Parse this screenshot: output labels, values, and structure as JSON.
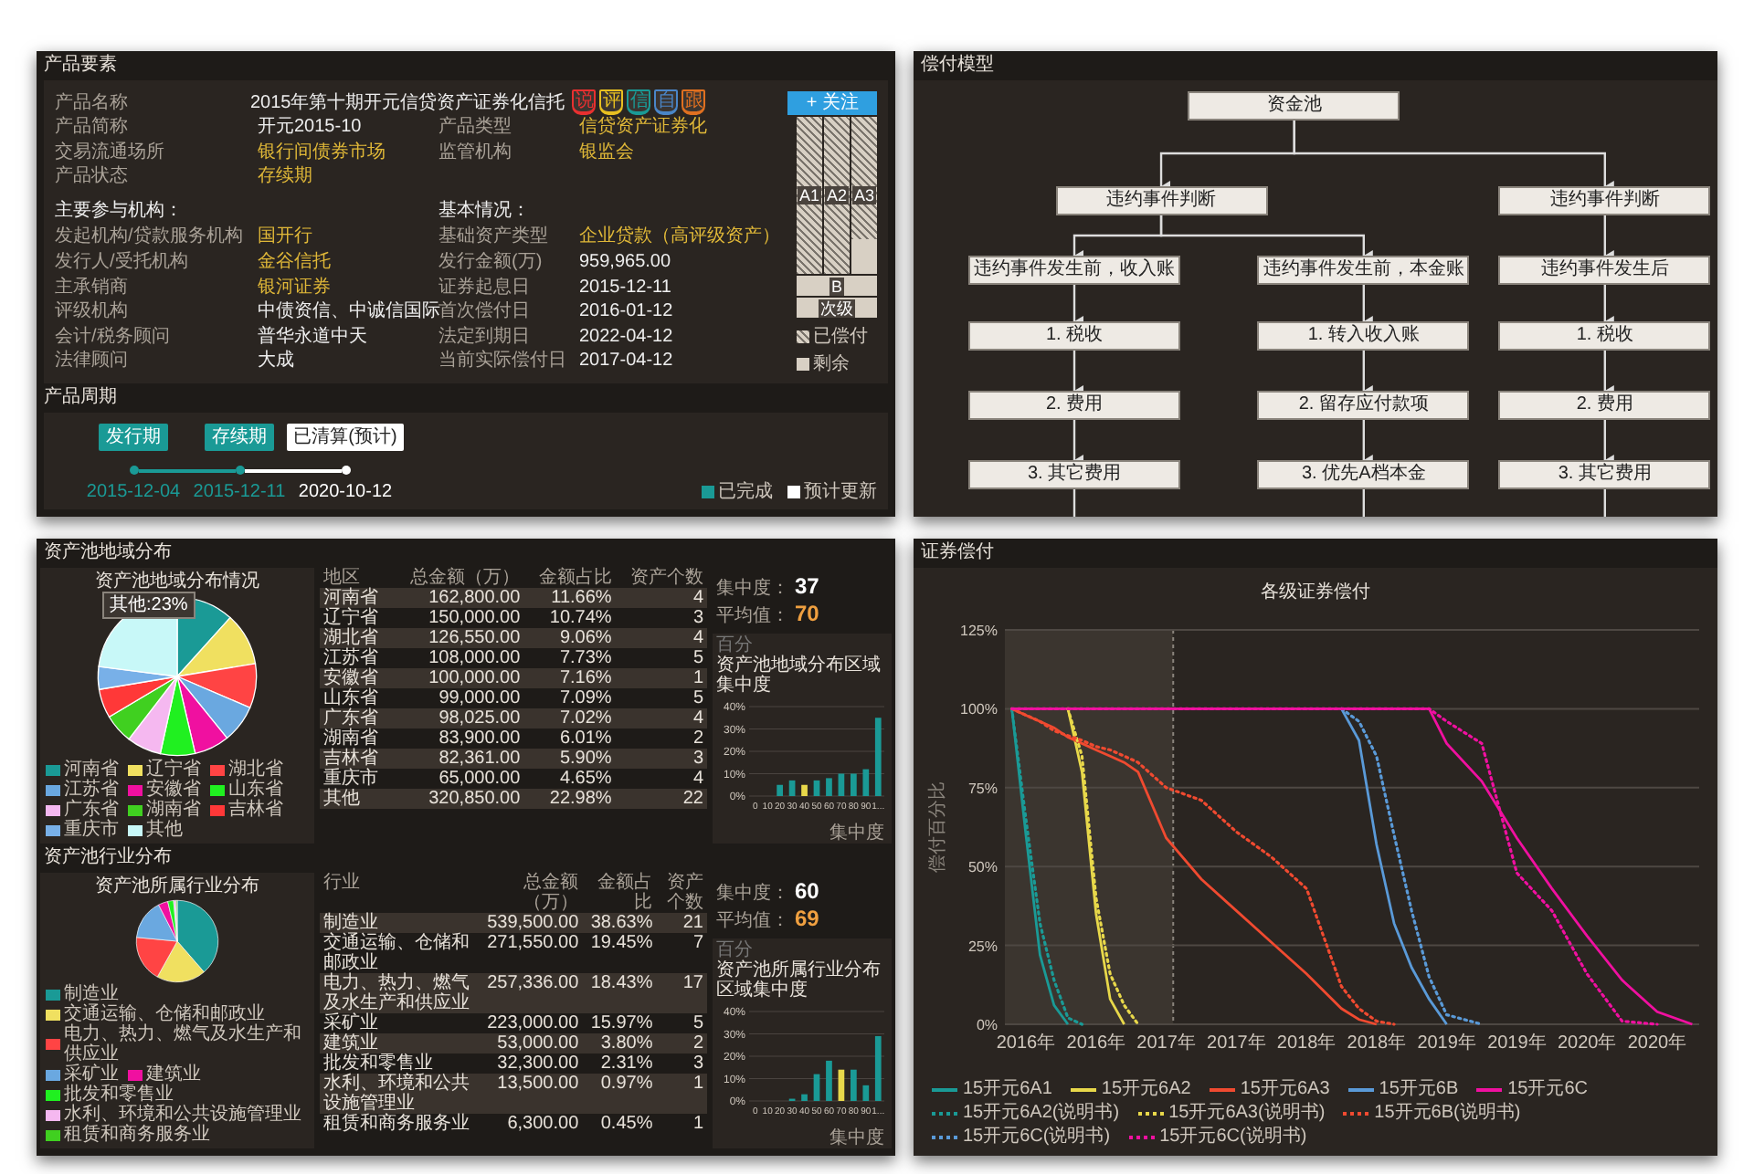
{
  "product_elements": {
    "title": "产品要素",
    "name_label": "产品名称",
    "name_value": "2015年第十期开元信贷资产证券化信托",
    "badges": [
      {
        "text": "说",
        "color": "#e83030"
      },
      {
        "text": "评",
        "color": "#e8c020"
      },
      {
        "text": "信",
        "color": "#1a9a96"
      },
      {
        "text": "自",
        "color": "#4a86c8"
      },
      {
        "text": "跟",
        "color": "#e07020"
      }
    ],
    "follow_button": "+ 关注",
    "info_rows": [
      [
        {
          "label": "产品简称",
          "value": "开元2015-10",
          "linked": false
        },
        {
          "label": "产品类型",
          "value": "信贷资产证券化",
          "linked": true
        }
      ],
      [
        {
          "label": "交易流通场所",
          "value": "银行间债券市场",
          "linked": true
        },
        {
          "label": "监管机构",
          "value": "银监会",
          "linked": true
        }
      ],
      [
        {
          "label": "产品状态",
          "value": "存续期",
          "linked": true
        }
      ]
    ],
    "headings": [
      "主要参与机构：",
      "基本情况："
    ],
    "detail_rows": [
      [
        {
          "label": "发起机构/贷款服务机构",
          "value": "国开行",
          "linked": true
        },
        {
          "label": "基础资产类型",
          "value": "企业贷款（高评级资产）",
          "linked": true
        }
      ],
      [
        {
          "label": "发行人/受托机构",
          "value": "金谷信托",
          "linked": true
        },
        {
          "label": "发行金额(万)",
          "value": "959,965.00",
          "linked": false
        }
      ],
      [
        {
          "label": "主承销商",
          "value": "银河证券",
          "linked": true
        },
        {
          "label": "证券起息日",
          "value": "2015-12-11",
          "linked": false
        }
      ],
      [
        {
          "label": "评级机构",
          "value": "中债资信、中诚信国际",
          "linked": false
        },
        {
          "label": "首次偿付日",
          "value": "2016-01-12",
          "linked": false
        }
      ],
      [
        {
          "label": "会计/税务顾问",
          "value": "普华永道中天",
          "linked": false
        },
        {
          "label": "法定到期日",
          "value": "2022-04-12",
          "linked": false
        }
      ],
      [
        {
          "label": "法律顾问",
          "value": "大成",
          "linked": false
        },
        {
          "label": "当前实际偿付日",
          "value": "2017-04-12",
          "linked": false
        }
      ]
    ],
    "tranches": [
      {
        "label": "A1",
        "kind": "column",
        "level": 1
      },
      {
        "label": "A2",
        "kind": "column",
        "level": 1
      },
      {
        "label": "A3",
        "kind": "column",
        "level": 0.78
      },
      {
        "label": "B",
        "kind": "row",
        "level": 0
      },
      {
        "label": "次级",
        "kind": "row",
        "level": 0
      }
    ],
    "tranche_legend": [
      "已偿付",
      "剩余"
    ]
  },
  "product_cycle": {
    "title": "产品周期",
    "stages": [
      {
        "label": "发行期",
        "date": "2015-12-04",
        "done": true
      },
      {
        "label": "存续期",
        "date": "2015-12-11",
        "done": true
      },
      {
        "label": "已清算(预计)",
        "date": "2020-10-12",
        "done": false
      }
    ],
    "legend": [
      "已完成",
      "预计更新"
    ]
  },
  "payment_model": {
    "title": "偿付模型",
    "root": {
      "text": "资金池",
      "children": [
        {
          "text": "违约事件判断",
          "children": [
            {
              "text": "违约事件发生前，收入账",
              "children": [
                {
                  "text": "1. 税收",
                  "children": [
                    {
                      "text": "2. 费用",
                      "children": [
                        {
                          "text": "3. 其它费用"
                        }
                      ]
                    }
                  ]
                }
              ]
            },
            {
              "text": "违约事件发生前，本金账",
              "children": [
                {
                  "text": "1. 转入收入账",
                  "children": [
                    {
                      "text": "2. 留存应付款项",
                      "children": [
                        {
                          "text": "3. 优先A档本金"
                        }
                      ]
                    }
                  ]
                }
              ]
            }
          ]
        },
        {
          "text": "违约事件判断",
          "children": [
            {
              "text": "违约事件发生后",
              "children": [
                {
                  "text": "1. 税收",
                  "children": [
                    {
                      "text": "2. 费用",
                      "children": [
                        {
                          "text": "3. 其它费用"
                        }
                      ]
                    }
                  ]
                }
              ]
            }
          ]
        }
      ]
    }
  },
  "asset_distribution": [
    {
      "title": "资产池地域分布",
      "pie": {
        "tooltip": "其他:23%",
        "chart_data": {
          "type": "pie",
          "title": "资产池地域分布情况",
          "categories": [
            "河南省",
            "辽宁省",
            "湖北省",
            "江苏省",
            "安徽省",
            "山东省",
            "广东省",
            "湖南省",
            "吉林省",
            "重庆市",
            "其他"
          ],
          "values": [
            11.66,
            10.74,
            9.06,
            7.73,
            7.16,
            7.09,
            7.02,
            6.01,
            5.9,
            4.65,
            22.98
          ],
          "colors": [
            "#1a9a96",
            "#f0e060",
            "#ff4444",
            "#6aa8e0",
            "#f010a0",
            "#20f020",
            "#f5b8f0",
            "#40d020",
            "#ff3838",
            "#78b0e8",
            "#c8f8f8"
          ]
        }
      },
      "table": {
        "columns": [
          "地区",
          "总金额（万）",
          "金额占比",
          "资产个数"
        ],
        "rows": [
          [
            "河南省",
            "162,800.00",
            "11.66%",
            "4"
          ],
          [
            "辽宁省",
            "150,000.00",
            "10.74%",
            "3"
          ],
          [
            "湖北省",
            "126,550.00",
            "9.06%",
            "4"
          ],
          [
            "江苏省",
            "108,000.00",
            "7.73%",
            "5"
          ],
          [
            "安徽省",
            "100,000.00",
            "7.16%",
            "1"
          ],
          [
            "山东省",
            "99,000.00",
            "7.09%",
            "5"
          ],
          [
            "广东省",
            "98,025.00",
            "7.02%",
            "4"
          ],
          [
            "湖南省",
            "83,900.00",
            "6.01%",
            "2"
          ],
          [
            "吉林省",
            "82,361.00",
            "5.90%",
            "3"
          ],
          [
            "重庆市",
            "65,000.00",
            "4.65%",
            "4"
          ],
          [
            "其他",
            "320,850.00",
            "22.98%",
            "22"
          ]
        ]
      },
      "concentration_label": "集中度：",
      "concentration": "37",
      "average_label": "平均值：",
      "average": "70",
      "bars": {
        "chart_data": {
          "type": "bar",
          "title": "资产池地域分布区域集中度",
          "ylabel": "百分",
          "xlabel": "集中度",
          "stacked": true,
          "grid": true,
          "categories": [
            "0",
            "10",
            "20",
            "30",
            "40",
            "50",
            "60",
            "70",
            "80",
            "90",
            "1..."
          ],
          "ylim": [
            0,
            40
          ],
          "yticks": [
            {
              "value": 0,
              "label": "0%"
            },
            {
              "value": 10,
              "label": "10%"
            },
            {
              "value": 20,
              "label": "20%"
            },
            {
              "value": 30,
              "label": "30%"
            },
            {
              "value": 40,
              "label": "40%"
            }
          ],
          "series": [
            {
              "color": "#1a9a96",
              "values": [
                null,
                null,
                5,
                7,
                null,
                7,
                8,
                10,
                10,
                12,
                35
              ]
            },
            {
              "color": "#e8d84a",
              "values": [
                null,
                null,
                null,
                null,
                5,
                null,
                null,
                null,
                null,
                null,
                null
              ]
            }
          ]
        }
      }
    },
    {
      "title": "资产池行业分布",
      "pie": {
        "chart_data": {
          "type": "pie",
          "title": "资产池所属行业分布",
          "categories": [
            "制造业",
            "交通运输、仓储和邮政业",
            "电力、热力、燃气及水生产和供应业",
            "采矿业",
            "建筑业",
            "批发和零售业",
            "水利、环境和公共设施管理业",
            "租赁和商务服务业"
          ],
          "values": [
            38.63,
            19.45,
            18.43,
            15.97,
            3.8,
            2.31,
            0.97,
            0.45
          ],
          "colors": [
            "#1a9a96",
            "#f0e060",
            "#ff4444",
            "#6aa8e0",
            "#f010a0",
            "#20f020",
            "#f5b8f0",
            "#40d020"
          ]
        }
      },
      "table": {
        "columns": [
          "行业",
          "总金额（万）",
          "金额占比",
          "资产个数"
        ],
        "rows": [
          [
            "制造业",
            "539,500.00",
            "38.63%",
            "21"
          ],
          [
            "交通运输、仓储和邮政业",
            "271,550.00",
            "19.45%",
            "7"
          ],
          [
            "电力、热力、燃气及水生产和供应业",
            "257,336.00",
            "18.43%",
            "17"
          ],
          [
            "采矿业",
            "223,000.00",
            "15.97%",
            "5"
          ],
          [
            "建筑业",
            "53,000.00",
            "3.80%",
            "2"
          ],
          [
            "批发和零售业",
            "32,300.00",
            "2.31%",
            "3"
          ],
          [
            "水利、环境和公共设施管理业",
            "13,500.00",
            "0.97%",
            "1"
          ],
          [
            "租赁和商务服务业",
            "6,300.00",
            "0.45%",
            "1"
          ]
        ]
      },
      "concentration_label": "集中度：",
      "concentration": "60",
      "average_label": "平均值：",
      "average": "69",
      "bars": {
        "chart_data": {
          "type": "bar",
          "title": "资产池所属行业分布区域集中度",
          "ylabel": "百分",
          "xlabel": "集中度",
          "stacked": true,
          "grid": true,
          "categories": [
            "0",
            "10",
            "20",
            "30",
            "40",
            "50",
            "60",
            "70",
            "80",
            "90",
            "1..."
          ],
          "ylim": [
            0,
            40
          ],
          "yticks": [
            {
              "value": 0,
              "label": "0%"
            },
            {
              "value": 10,
              "label": "10%"
            },
            {
              "value": 20,
              "label": "20%"
            },
            {
              "value": 30,
              "label": "30%"
            },
            {
              "value": 40,
              "label": "40%"
            }
          ],
          "series": [
            {
              "color": "#1a9a96",
              "values": [
                null,
                null,
                null,
                1,
                3,
                12,
                18,
                null,
                14,
                7,
                29
              ]
            },
            {
              "color": "#e8d84a",
              "values": [
                null,
                null,
                null,
                null,
                null,
                null,
                null,
                14,
                null,
                null,
                null
              ]
            }
          ]
        }
      }
    }
  ],
  "securities_repayment": {
    "title": "证券偿付",
    "chart_data": {
      "type": "line",
      "title": "各级证券偿付",
      "ylabel": "偿付百分比",
      "grid": true,
      "x": [
        2015.9,
        2016,
        2016.1,
        2016.2,
        2016.3,
        2016.4,
        2016.5,
        2016.6,
        2016.7,
        2016.8,
        2017,
        2017.25,
        2017.5,
        2017.75,
        2018,
        2018.25,
        2018.375,
        2018.5,
        2018.625,
        2018.75,
        2018.875,
        2019,
        2019.25,
        2019.5,
        2019.75,
        2020,
        2020.25,
        2020.5,
        2020.75
      ],
      "xlim": [
        2015.85,
        2020.8
      ],
      "ylim": [
        0,
        125
      ],
      "xticks": [
        {
          "value": 2016,
          "label": "2016年"
        },
        {
          "value": 2016.5,
          "label": "2016年"
        },
        {
          "value": 2017,
          "label": "2017年"
        },
        {
          "value": 2017.5,
          "label": "2017年"
        },
        {
          "value": 2018,
          "label": "2018年"
        },
        {
          "value": 2018.5,
          "label": "2018年"
        },
        {
          "value": 2019,
          "label": "2019年"
        },
        {
          "value": 2019.5,
          "label": "2019年"
        },
        {
          "value": 2020,
          "label": "2020年"
        },
        {
          "value": 2020.5,
          "label": "2020年"
        }
      ],
      "yticks": [
        {
          "value": 0,
          "label": "0%"
        },
        {
          "value": 25,
          "label": "25%"
        },
        {
          "value": 50,
          "label": "50%"
        },
        {
          "value": 75,
          "label": "75%"
        },
        {
          "value": 100,
          "label": "100%"
        },
        {
          "value": 125,
          "label": "125%"
        }
      ],
      "bands": [
        {
          "axis": "x",
          "from": 2015.85,
          "to": 2017.05
        }
      ],
      "ref_lines": [
        {
          "axis": "x",
          "value": 2017.05
        }
      ],
      "series": [
        {
          "name": "15开元6A1",
          "color": "#1a9a96",
          "values": [
            100,
            60,
            22,
            6,
            0,
            null,
            null,
            null,
            null,
            null,
            null,
            null,
            null,
            null,
            null,
            null,
            null,
            null,
            null,
            null,
            null,
            null,
            null,
            null,
            null,
            null,
            null,
            null,
            null
          ]
        },
        {
          "name": "15开元6A2",
          "color": "#e8d84a",
          "values": [
            null,
            null,
            null,
            null,
            100,
            80,
            35,
            8,
            0,
            null,
            null,
            null,
            null,
            null,
            null,
            null,
            null,
            null,
            null,
            null,
            null,
            null,
            null,
            null,
            null,
            null,
            null,
            null,
            null
          ]
        },
        {
          "name": "15开元6A3",
          "color": "#f04a30",
          "values": [
            100,
            98,
            96,
            94,
            91,
            89,
            87,
            85,
            83,
            80,
            59,
            46,
            36,
            26,
            16,
            5,
            1.5,
            0,
            null,
            null,
            null,
            null,
            null,
            null,
            null,
            null,
            null,
            null,
            null
          ]
        },
        {
          "name": "15开元6B",
          "color": "#5a9ad8",
          "values": [
            null,
            null,
            null,
            null,
            null,
            null,
            null,
            null,
            null,
            null,
            null,
            null,
            null,
            null,
            null,
            100,
            90,
            57,
            32,
            18,
            8,
            0,
            null,
            null,
            null,
            null,
            null,
            null,
            null
          ]
        },
        {
          "name": "15开元6C",
          "color": "#f010a0",
          "values": [
            100,
            100,
            100,
            100,
            100,
            100,
            100,
            100,
            100,
            100,
            100,
            100,
            100,
            100,
            100,
            100,
            100,
            100,
            100,
            100,
            100,
            89,
            77,
            59,
            43,
            28,
            14,
            4,
            0
          ]
        },
        {
          "name": "15开元6A2(说明书)",
          "color": "#1a9a96",
          "line_style": "dotted",
          "values": [
            100,
            65,
            32,
            14,
            2,
            0,
            null,
            null,
            null,
            null,
            null,
            null,
            null,
            null,
            null,
            null,
            null,
            null,
            null,
            null,
            null,
            null,
            null,
            null,
            null,
            null,
            null,
            null,
            null
          ]
        },
        {
          "name": "15开元6A3(说明书)",
          "color": "#e8d84a",
          "line_style": "dotted",
          "values": [
            null,
            null,
            null,
            null,
            100,
            85,
            40,
            16,
            6,
            0,
            null,
            null,
            null,
            null,
            null,
            null,
            null,
            null,
            null,
            null,
            null,
            null,
            null,
            null,
            null,
            null,
            null,
            null,
            null
          ]
        },
        {
          "name": "15开元6B(说明书)",
          "color": "#f04a30",
          "line_style": "dotted",
          "values": [
            100,
            98,
            96,
            93,
            91.5,
            90,
            88,
            87,
            85,
            83,
            75,
            71,
            61,
            53,
            43,
            12,
            5,
            1,
            0,
            null,
            null,
            null,
            null,
            null,
            null,
            null,
            null,
            null,
            null
          ]
        },
        {
          "name": "15开元6C(说明书)",
          "color": "#5a9ad8",
          "line_style": "dotted",
          "values": [
            null,
            null,
            null,
            null,
            null,
            null,
            null,
            null,
            null,
            null,
            null,
            null,
            null,
            null,
            null,
            100,
            96,
            85,
            60,
            36,
            15,
            3,
            0,
            null,
            null,
            null,
            null,
            null,
            null
          ]
        },
        {
          "name": "15开元6C(说明书)",
          "color": "#f010a0",
          "line_style": "dotted",
          "values": [
            100,
            100,
            100,
            100,
            100,
            100,
            100,
            100,
            100,
            100,
            100,
            100,
            100,
            100,
            100,
            100,
            100,
            100,
            100,
            100,
            100,
            96,
            89,
            48,
            36,
            16,
            1,
            0,
            null
          ]
        }
      ]
    }
  }
}
